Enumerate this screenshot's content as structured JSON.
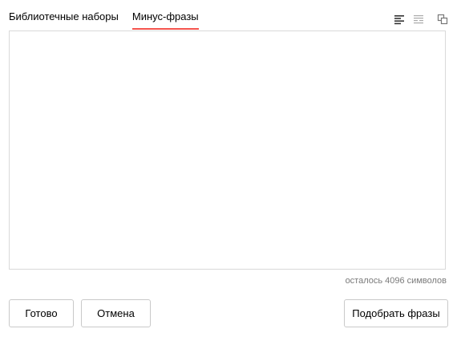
{
  "tabs": [
    {
      "label": "Библиотечные наборы",
      "active": false
    },
    {
      "label": "Минус-фразы",
      "active": true
    }
  ],
  "toolbar": {
    "icons": [
      "align-left-icon",
      "wrap-lines-icon",
      "copy-window-icon"
    ]
  },
  "editor": {
    "value": "",
    "placeholder": ""
  },
  "counter": {
    "text": "осталось 4096 символов"
  },
  "buttons": {
    "done_label": "Готово",
    "cancel_label": "Отмена",
    "suggest_label": "Подобрать фразы"
  },
  "colors": {
    "active_tab_underline": "#f5544d",
    "border": "#d9d9d9",
    "muted_text": "#7a7a7a"
  }
}
